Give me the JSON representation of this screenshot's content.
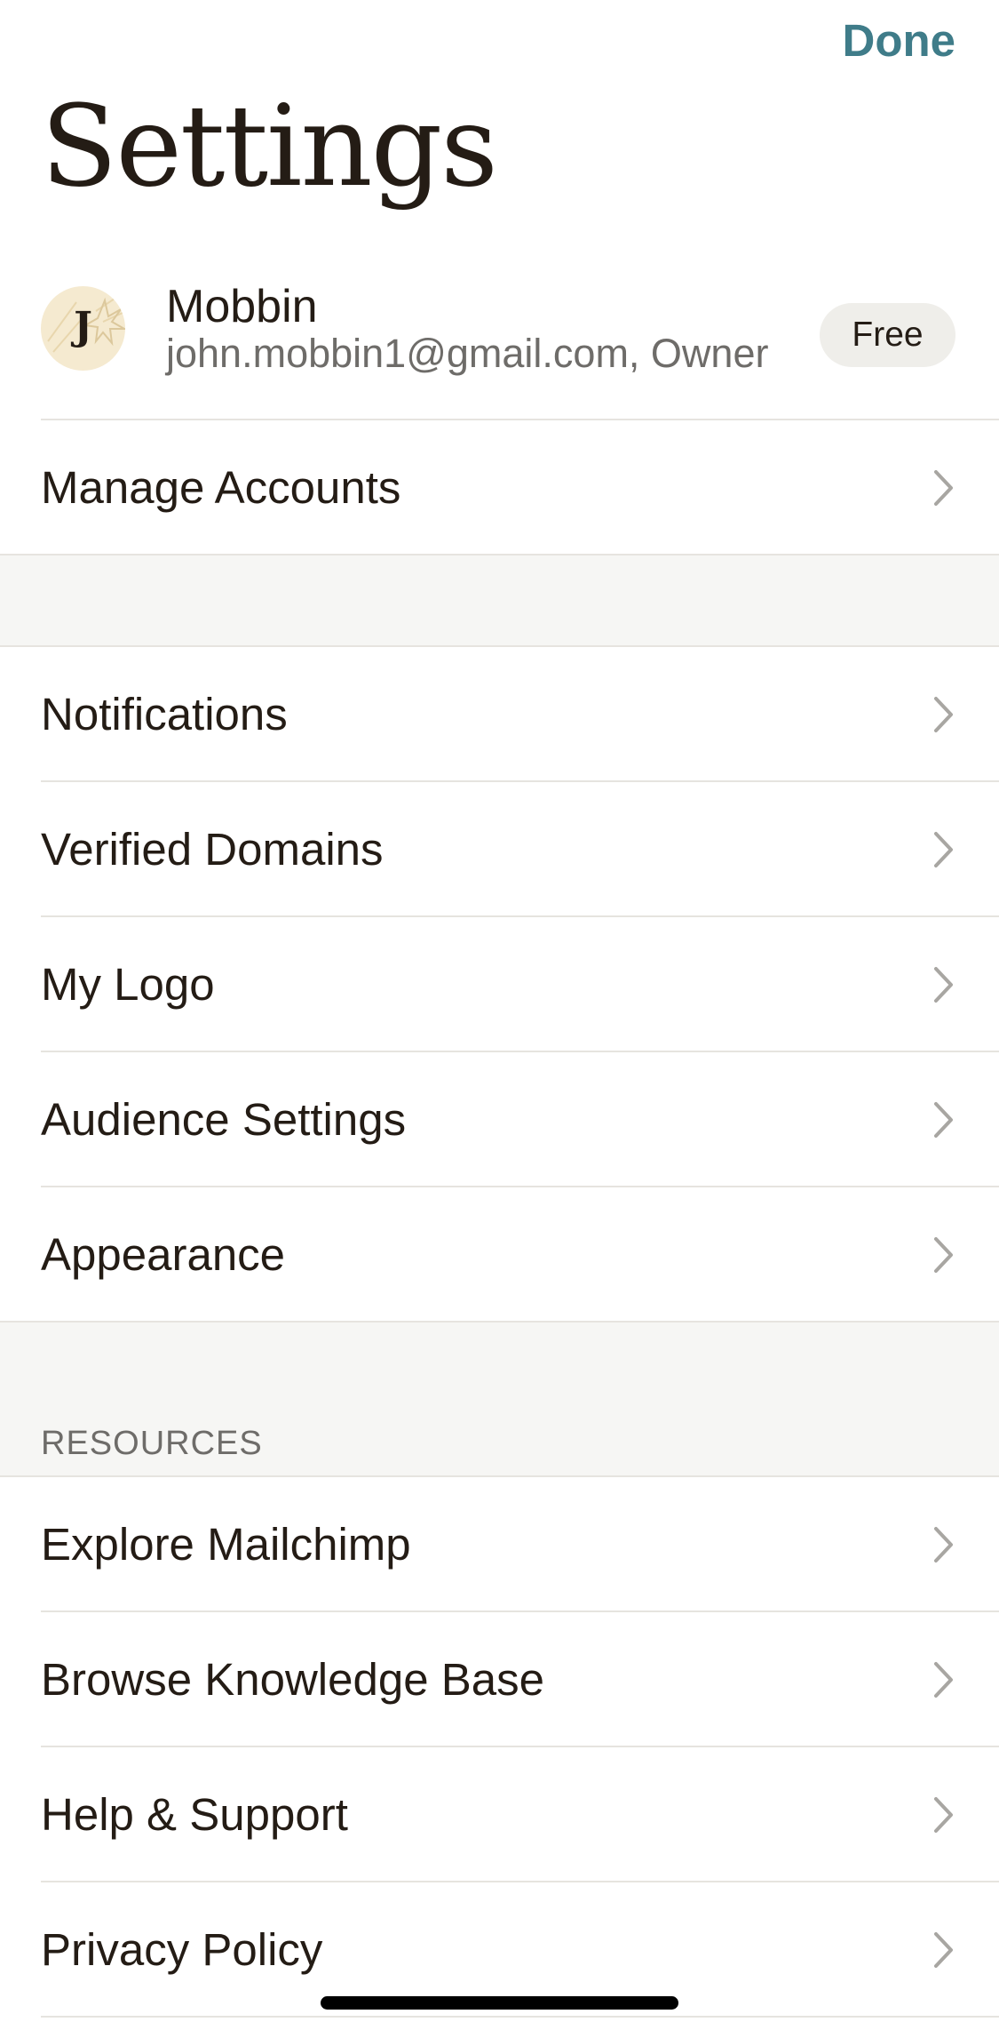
{
  "header": {
    "done_label": "Done",
    "title": "Settings"
  },
  "account": {
    "avatar_letter": "J",
    "name": "Mobbin",
    "email_role": "john.mobbin1@gmail.com, Owner",
    "plan_badge": "Free",
    "manage_label": "Manage Accounts"
  },
  "preferences": {
    "items": [
      {
        "label": "Notifications"
      },
      {
        "label": "Verified Domains"
      },
      {
        "label": "My Logo"
      },
      {
        "label": "Audience Settings"
      },
      {
        "label": "Appearance"
      }
    ]
  },
  "resources": {
    "header": "RESOURCES",
    "items": [
      {
        "label": "Explore Mailchimp"
      },
      {
        "label": "Browse Knowledge Base"
      },
      {
        "label": "Help & Support"
      },
      {
        "label": "Privacy Policy"
      }
    ]
  },
  "colors": {
    "accent": "#3f7c89",
    "text": "#241c15",
    "secondary_text": "#6e6c69",
    "section_background": "#f6f6f4",
    "avatar_background": "#f5ead0"
  },
  "icons": {
    "row_chevron": "chevron-right-icon"
  }
}
